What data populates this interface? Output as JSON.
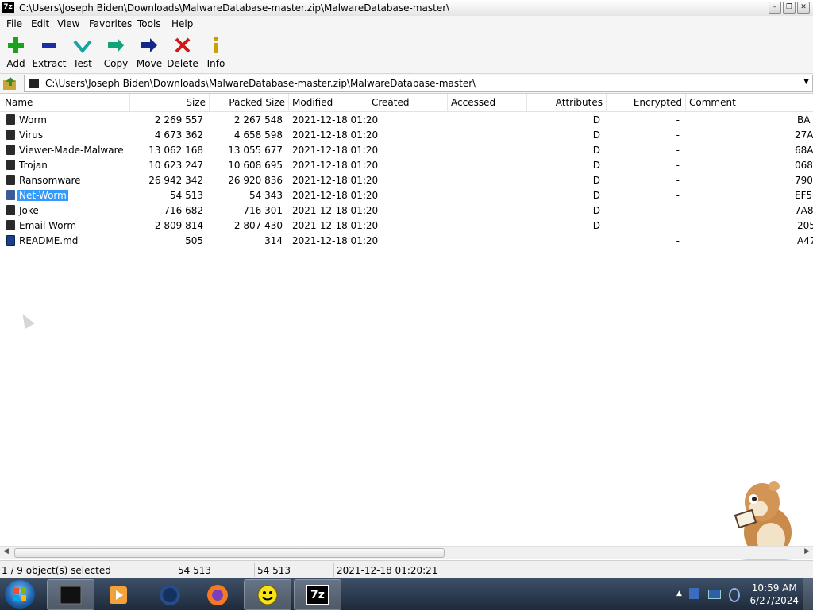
{
  "window": {
    "title": "C:\\Users\\Joseph Biden\\Downloads\\MalwareDatabase-master.zip\\MalwareDatabase-master\\",
    "app_icon_text": "7z"
  },
  "menu": [
    "File",
    "Edit",
    "View",
    "Favorites",
    "Tools",
    "Help"
  ],
  "toolbar": [
    {
      "label": "Add",
      "icon": "plus-icon",
      "color": "#1aa31a"
    },
    {
      "label": "Extract",
      "icon": "minus-icon",
      "color": "#1a2ea3"
    },
    {
      "label": "Test",
      "icon": "check-icon",
      "color": "#18a3a3"
    },
    {
      "label": "Copy",
      "icon": "double-arrow-icon",
      "color": "#13a37a"
    },
    {
      "label": "Move",
      "icon": "arrow-right-icon",
      "color": "#13288a"
    },
    {
      "label": "Delete",
      "icon": "x-icon",
      "color": "#d01818"
    },
    {
      "label": "Info",
      "icon": "info-icon",
      "color": "#c8a000"
    }
  ],
  "address": {
    "path": "C:\\Users\\Joseph Biden\\Downloads\\MalwareDatabase-master.zip\\MalwareDatabase-master\\"
  },
  "columns": [
    "Name",
    "Size",
    "Packed Size",
    "Modified",
    "Created",
    "Accessed",
    "Attributes",
    "Encrypted",
    "Comment"
  ],
  "files": [
    {
      "name": "Worm",
      "size": "2 269 557",
      "packed": "2 267 548",
      "modified": "2021-12-18 01:20",
      "attributes": "D",
      "encrypted": "-",
      "crc": "BA",
      "type": "folder"
    },
    {
      "name": "Virus",
      "size": "4 673 362",
      "packed": "4 658 598",
      "modified": "2021-12-18 01:20",
      "attributes": "D",
      "encrypted": "-",
      "crc": "27A",
      "type": "folder"
    },
    {
      "name": "Viewer-Made-Malware",
      "size": "13 062 168",
      "packed": "13 055 677",
      "modified": "2021-12-18 01:20",
      "attributes": "D",
      "encrypted": "-",
      "crc": "68A",
      "type": "folder"
    },
    {
      "name": "Trojan",
      "size": "10 623 247",
      "packed": "10 608 695",
      "modified": "2021-12-18 01:20",
      "attributes": "D",
      "encrypted": "-",
      "crc": "068",
      "type": "folder"
    },
    {
      "name": "Ransomware",
      "size": "26 942 342",
      "packed": "26 920 836",
      "modified": "2021-12-18 01:20",
      "attributes": "D",
      "encrypted": "-",
      "crc": "790",
      "type": "folder"
    },
    {
      "name": "Net-Worm",
      "size": "54 513",
      "packed": "54 343",
      "modified": "2021-12-18 01:20",
      "attributes": "D",
      "encrypted": "-",
      "crc": "EF5",
      "type": "folder",
      "selected": true
    },
    {
      "name": "Joke",
      "size": "716 682",
      "packed": "716 301",
      "modified": "2021-12-18 01:20",
      "attributes": "D",
      "encrypted": "-",
      "crc": "7A8",
      "type": "folder"
    },
    {
      "name": "Email-Worm",
      "size": "2 809 814",
      "packed": "2 807 430",
      "modified": "2021-12-18 01:20",
      "attributes": "D",
      "encrypted": "-",
      "crc": "205",
      "type": "folder"
    },
    {
      "name": "README.md",
      "size": "505",
      "packed": "314",
      "modified": "2021-12-18 01:20",
      "attributes": "",
      "encrypted": "-",
      "crc": "A47",
      "type": "file"
    }
  ],
  "status": {
    "selection": "1 / 9 object(s) selected",
    "size": "54 513",
    "packed": "54 513",
    "modified": "2021-12-18 01:20:21"
  },
  "taskbar": {
    "time": "10:59 AM",
    "date": "6/27/2024",
    "apps": [
      "terminal-icon",
      "media-player-icon",
      "browser-globe-icon",
      "firefox-icon",
      "smiley-icon",
      "7zip-icon"
    ],
    "sevenzip_label": "7z"
  },
  "colors": {
    "selection": "#3399ff",
    "taskbar": "#2a3a50"
  }
}
